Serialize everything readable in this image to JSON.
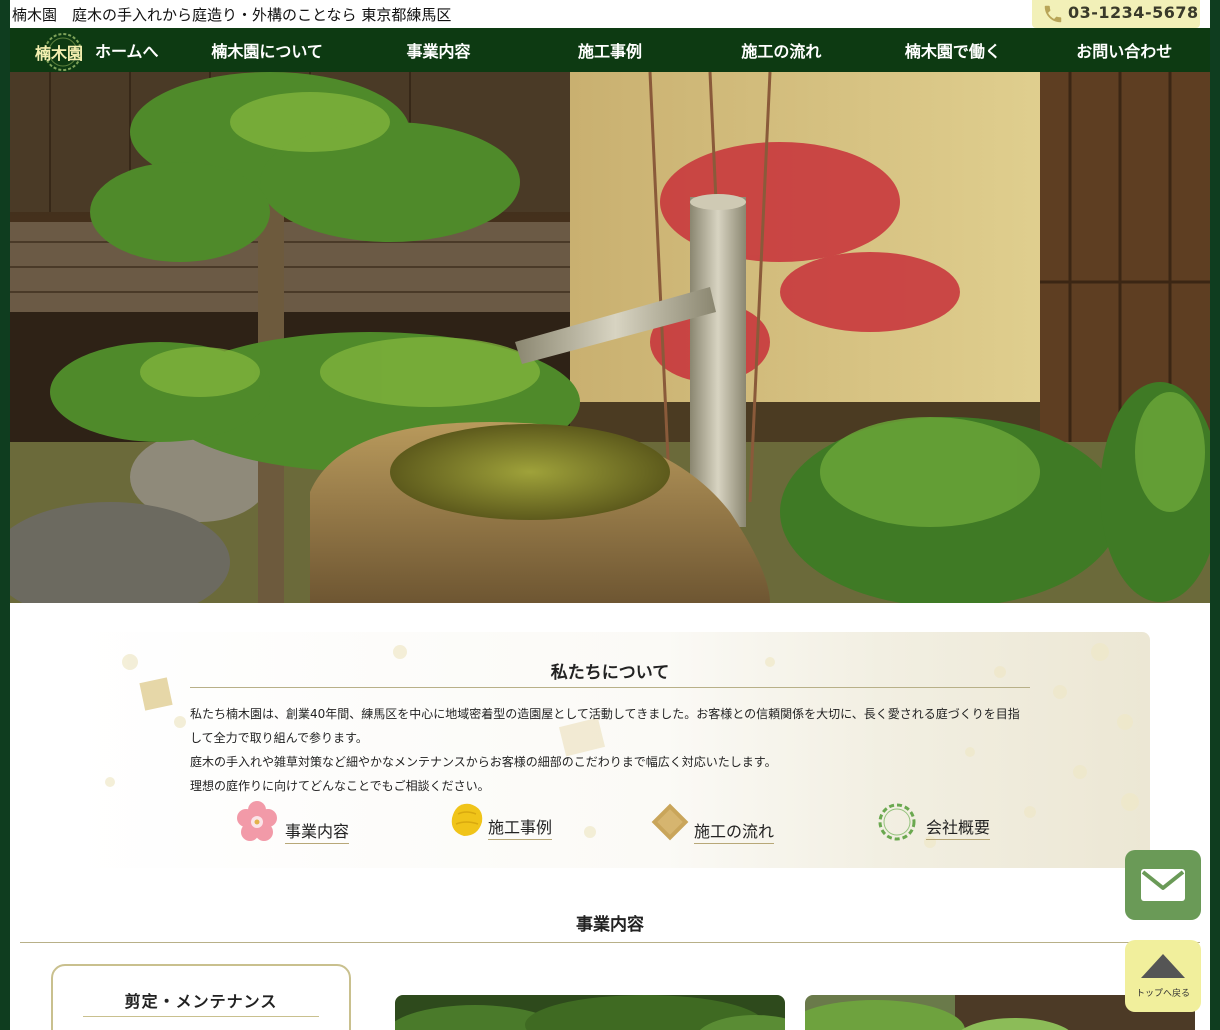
{
  "header": {
    "tagline": "楠木園　庭木の手入れから庭造り・外構のことなら 東京都練馬区",
    "phone": "03-1234-5678"
  },
  "nav": {
    "logo_text": "楠木園",
    "items": [
      "ホームへ",
      "楠木園について",
      "事業内容",
      "施工事例",
      "施工の流れ",
      "楠木園で働く",
      "お問い合わせ"
    ]
  },
  "about": {
    "title": "私たちについて",
    "paragraphs": [
      "私たち楠木園は、創業40年間、練馬区を中心に地域密着型の造園屋として活動してきました。お客様との信頼関係を大切に、長く愛される庭づくりを目指して全力で取り組んで参ります。",
      "庭木の手入れや雑草対策など細やかなメンテナンスからお客様の細部のこだわりまで幅広く対応いたします。",
      "理想の庭作りに向けてどんなことでもご相談ください。"
    ],
    "links": [
      "事業内容",
      "施工事例",
      "施工の流れ",
      "会社概要"
    ]
  },
  "services": {
    "title": "事業内容",
    "card_title": "剪定・メンテナンス"
  },
  "floating": {
    "totop_label": "トップへ戻る"
  },
  "colors": {
    "nav_bg": "#0d3a12",
    "phone_bg": "#f2f0b8",
    "mail_btn": "#6a9a57",
    "totop_btn": "#f1ef9c",
    "accent_rule": "#b8b088"
  }
}
